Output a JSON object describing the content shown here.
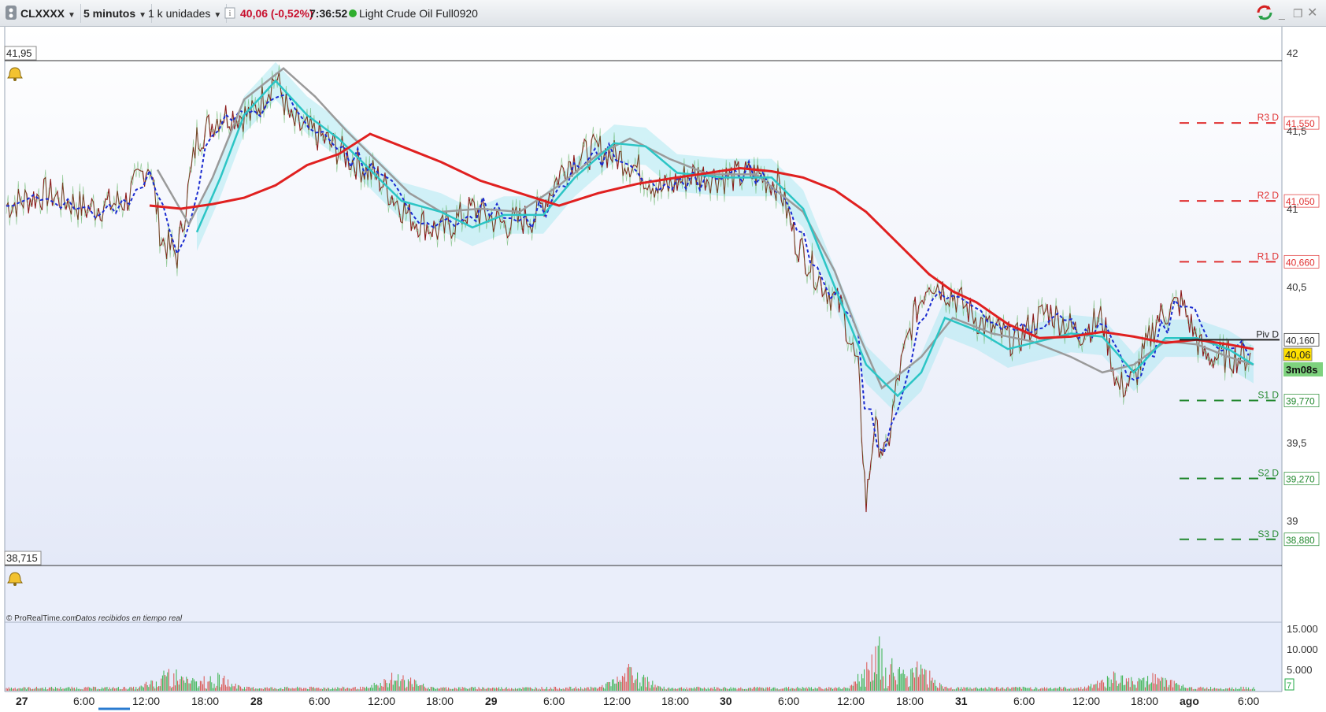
{
  "toolbar": {
    "symbol": "CLXXXX",
    "timeframe": "5 minutos",
    "units": "1 k unidades",
    "price_change": "40,06 (-0,52%)",
    "time": "7:36:52",
    "instrument": "Light Crude Oil Full0920",
    "status_color": "#2fae2f",
    "icons": [
      "app-menu-icon",
      "info-icon",
      "sync-icon",
      "minimize-icon",
      "restore-icon",
      "close-icon"
    ]
  },
  "chart": {
    "high_label": "41,95",
    "low_label": "38,715",
    "copyright": "© ProRealTime.com",
    "realtime_note": "Datos recibidos en tiempo real",
    "price_axis": [
      "42",
      "41,5",
      "41",
      "40,5",
      "39,5",
      "39"
    ],
    "volume_axis": [
      "15.000",
      "10.000",
      "5.000"
    ],
    "volume_last": "7",
    "time_axis": [
      "27",
      "6:00",
      "12:00",
      "18:00",
      "28",
      "6:00",
      "12:00",
      "18:00",
      "29",
      "6:00",
      "12:00",
      "18:00",
      "30",
      "6:00",
      "12:00",
      "18:00",
      "31",
      "6:00",
      "12:00",
      "18:00",
      "ago",
      "6:00"
    ],
    "pivots": [
      {
        "name": "R3 D",
        "value": "41,550",
        "color": "#e03030"
      },
      {
        "name": "R2 D",
        "value": "41,050",
        "color": "#e03030"
      },
      {
        "name": "R1 D",
        "value": "40,660",
        "color": "#e03030"
      },
      {
        "name": "Piv D",
        "value": "40,160",
        "color": "#222222"
      },
      {
        "name": "S1 D",
        "value": "39,770",
        "color": "#22882e"
      },
      {
        "name": "S2 D",
        "value": "39,270",
        "color": "#22882e"
      },
      {
        "name": "S3 D",
        "value": "38,880",
        "color": "#22882e"
      }
    ],
    "current_price": "40,06",
    "bar_timer": "3m08s",
    "colors": {
      "price": "#8b1a1a",
      "ma_red": "#e02020",
      "ma_cyan": "#2cc5c5",
      "ma_gray": "#9a9a9a",
      "ma_blue": "#1a2bd0"
    }
  }
}
